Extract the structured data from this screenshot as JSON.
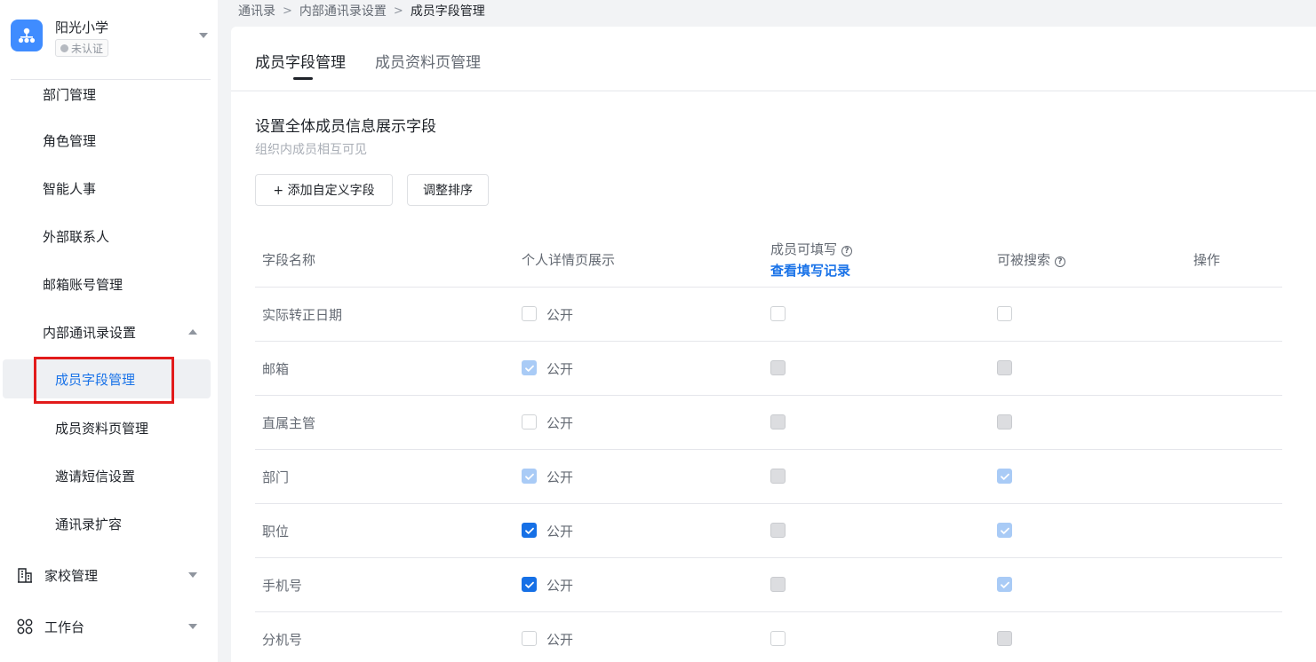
{
  "org": {
    "name": "阳光小学",
    "badge": "未认证"
  },
  "sidebar": {
    "items": [
      {
        "label": "部门管理"
      },
      {
        "label": "角色管理"
      },
      {
        "label": "智能人事"
      },
      {
        "label": "外部联系人"
      },
      {
        "label": "邮箱账号管理"
      },
      {
        "label": "内部通讯录设置"
      },
      {
        "label": "成员字段管理"
      },
      {
        "label": "成员资料页管理"
      },
      {
        "label": "邀请短信设置"
      },
      {
        "label": "通讯录扩容"
      },
      {
        "label": "家校管理"
      },
      {
        "label": "工作台"
      }
    ]
  },
  "breadcrumb": {
    "items": [
      "通讯录",
      "内部通讯录设置",
      "成员字段管理"
    ],
    "separator": ">"
  },
  "tabs": [
    {
      "label": "成员字段管理",
      "active": true
    },
    {
      "label": "成员资料页管理",
      "active": false
    }
  ],
  "section": {
    "title": "设置全体成员信息展示字段",
    "subtitle": "组织内成员相互可见"
  },
  "buttons": {
    "add_custom": "+ 添加自定义字段",
    "reorder": "调整排序"
  },
  "table": {
    "headers": {
      "name": "字段名称",
      "detail": "个人详情页展示",
      "fillable": "成员可填写",
      "fillable_link": "查看填写记录",
      "searchable": "可被搜索",
      "actions": "操作"
    },
    "public_label": "公开",
    "rows": [
      {
        "name": "实际转正日期",
        "detail": "unchecked",
        "fillable": "unchecked",
        "searchable": "unchecked"
      },
      {
        "name": "邮箱",
        "detail": "checked-disabled",
        "fillable": "disabled",
        "searchable": "disabled"
      },
      {
        "name": "直属主管",
        "detail": "unchecked",
        "fillable": "disabled",
        "searchable": "disabled"
      },
      {
        "name": "部门",
        "detail": "checked-disabled",
        "fillable": "disabled",
        "searchable": "checked-disabled"
      },
      {
        "name": "职位",
        "detail": "checked",
        "fillable": "disabled",
        "searchable": "checked-disabled"
      },
      {
        "name": "手机号",
        "detail": "checked",
        "fillable": "disabled",
        "searchable": "checked-disabled"
      },
      {
        "name": "分机号",
        "detail": "unchecked",
        "fillable": "unchecked",
        "searchable": "disabled"
      }
    ]
  },
  "colors": {
    "accent": "#1670e6",
    "link": "#1a73e8",
    "highlight_box": "#e21b1b",
    "logo": "#3f8cff"
  }
}
